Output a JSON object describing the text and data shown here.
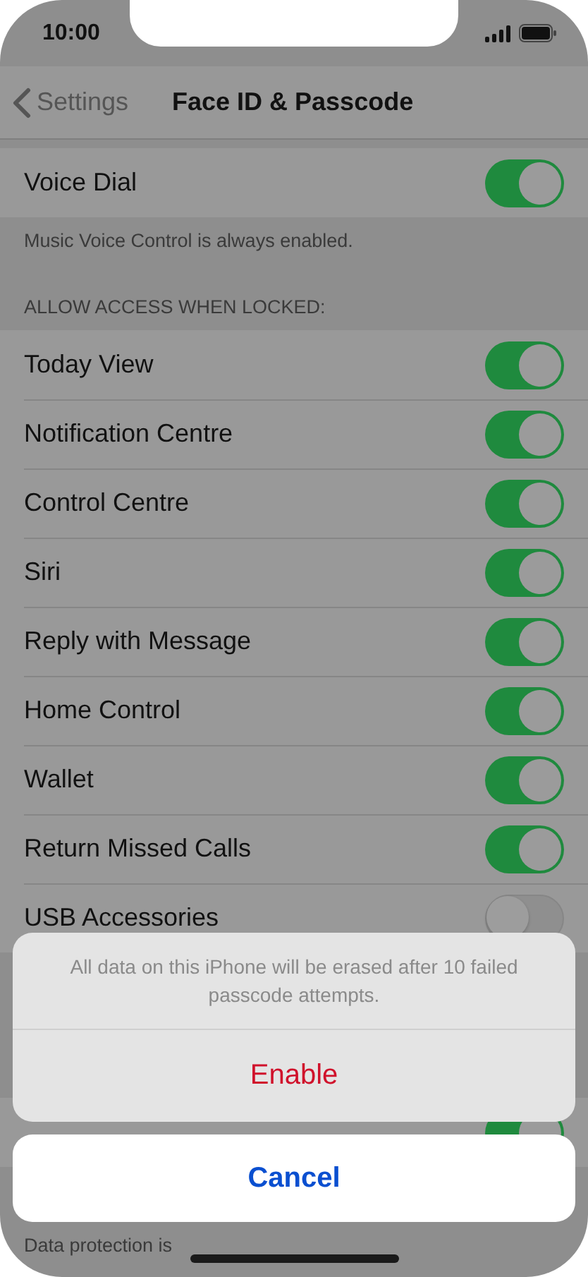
{
  "status_bar": {
    "time": "10:00"
  },
  "nav": {
    "back": "Settings",
    "title": "Face ID & Passcode"
  },
  "sections": [
    {
      "rows": [
        {
          "label": "Voice Dial",
          "on": true
        }
      ],
      "footer": "Music Voice Control is always enabled."
    },
    {
      "header": "ALLOW ACCESS WHEN LOCKED:",
      "rows": [
        {
          "label": "Today View",
          "on": true
        },
        {
          "label": "Notification Centre",
          "on": true
        },
        {
          "label": "Control Centre",
          "on": true
        },
        {
          "label": "Siri",
          "on": true
        },
        {
          "label": "Reply with Message",
          "on": true
        },
        {
          "label": "Home Control",
          "on": true
        },
        {
          "label": "Wallet",
          "on": true
        },
        {
          "label": "Return Missed Calls",
          "on": true
        },
        {
          "label": "USB Accessories",
          "on": false
        }
      ]
    },
    {
      "rows": [
        {
          "on": true
        }
      ],
      "footer": "Data protection is"
    }
  ],
  "action_sheet": {
    "message": "All data on this iPhone will be erased after 10 failed passcode attempts.",
    "actions": [
      {
        "label": "Enable",
        "kind": "destructive"
      }
    ],
    "cancel": "Cancel"
  }
}
